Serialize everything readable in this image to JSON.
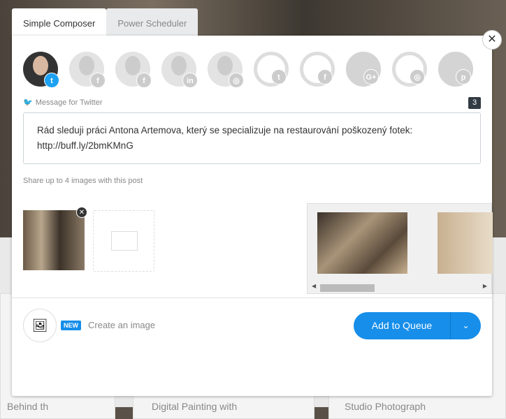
{
  "tabs": [
    {
      "label": "Simple Composer",
      "active": true
    },
    {
      "label": "Power Scheduler",
      "active": false
    }
  ],
  "profiles": [
    {
      "type": "person",
      "network": "twitter",
      "badge": "t",
      "active": true
    },
    {
      "type": "person",
      "network": "facebook",
      "badge": "f"
    },
    {
      "type": "person",
      "network": "facebook",
      "badge": "f"
    },
    {
      "type": "person",
      "network": "linkedin",
      "badge": "in"
    },
    {
      "type": "person",
      "network": "instagram",
      "badge": "◎"
    },
    {
      "type": "logo",
      "network": "twitter",
      "badge": "t"
    },
    {
      "type": "logo",
      "network": "facebook",
      "badge": "f"
    },
    {
      "type": "logo",
      "network": "google-plus",
      "badge": "G+",
      "dark": true
    },
    {
      "type": "logo",
      "network": "instagram",
      "badge": "◎"
    },
    {
      "type": "logo",
      "network": "pinterest",
      "badge": "p",
      "dark": true
    }
  ],
  "composer": {
    "label": "Message for Twitter",
    "char_count": "3",
    "message": "Rád sleduji práci Antona Artemova, který se specializuje na restaurování poškozený fotek: http://buff.ly/2bmKMnG",
    "share_hint": "Share up to 4 images with this post"
  },
  "footer": {
    "new_badge": "NEW",
    "create_image": "Create an image",
    "add_to_queue": "Add to Queue"
  },
  "colors": {
    "accent": "#168eea",
    "twitter": "#1da1f2"
  },
  "background": {
    "cards": [
      "Behind th",
      "Digital Painting with",
      "Studio Photograph"
    ]
  }
}
